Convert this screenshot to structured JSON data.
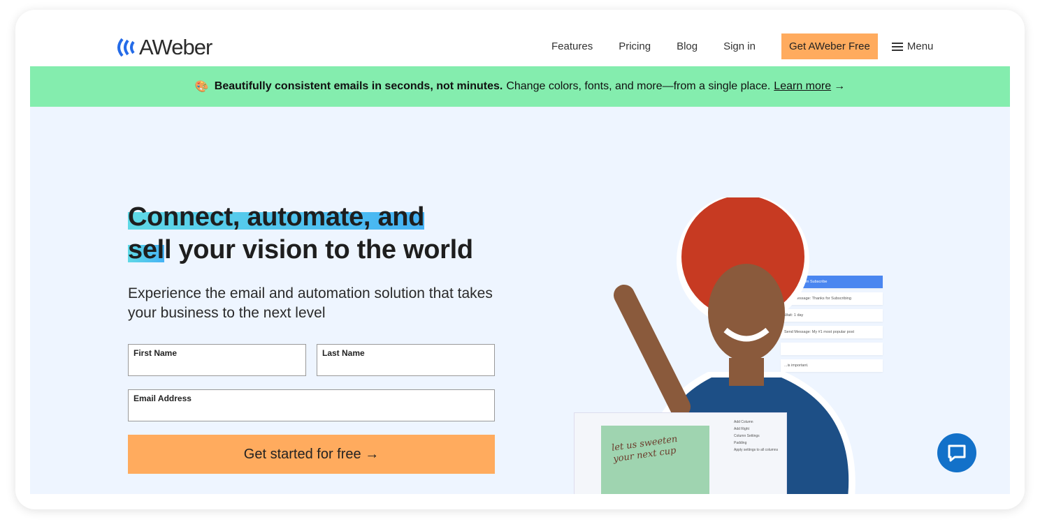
{
  "brand": {
    "name": "AWeber",
    "logo_color": "#246be8"
  },
  "nav": {
    "links": [
      "Features",
      "Pricing",
      "Blog",
      "Sign in"
    ],
    "cta": "Get AWeber Free",
    "menu": "Menu",
    "cta_color": "#ffab5e"
  },
  "banner": {
    "icon": "palette-icon",
    "bold": "Beautifully consistent emails in seconds, not minutes.",
    "text": "Change colors, fonts, and more—from a single place.",
    "link": "Learn more",
    "arrow": "→",
    "bg": "#84edae"
  },
  "hero": {
    "title_highlight_1": "Connect, automate, and",
    "title_highlight_2": "sel",
    "title_rest": "l your vision to the world",
    "subtitle": "Experience the email and automation solution that takes your business to the next level",
    "form": {
      "first_name": "First Name",
      "last_name": "Last Name",
      "email": "Email Address",
      "submit": "Get started for free →"
    }
  },
  "workflow": [
    "Campaign: On Subscribe",
    "Send Message: Thanks for Subscribing",
    "Wait: 1 day",
    "Send Message: My #1 most popular post",
    "",
    "...is important."
  ],
  "editor": {
    "image_text": "let us sweeten your next cup",
    "panel": [
      "Add Column",
      "Add Right",
      "Column Settings",
      "Padding",
      "Apply settings to all columns"
    ]
  },
  "chat": {
    "icon": "chat-icon"
  }
}
